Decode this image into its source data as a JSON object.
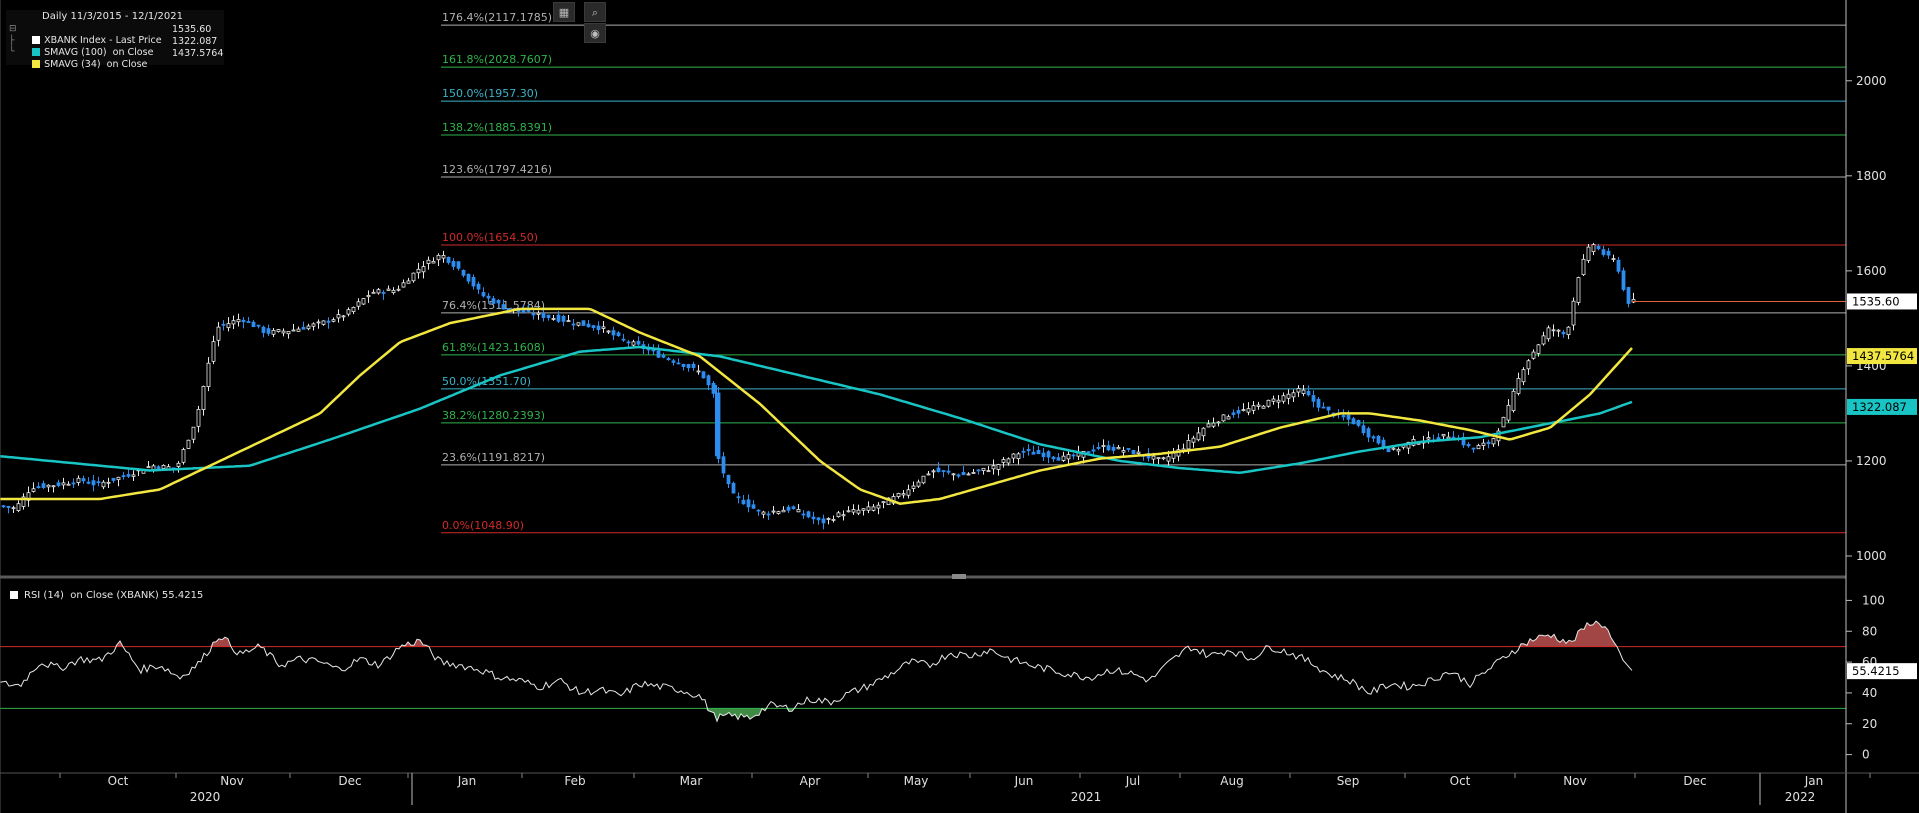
{
  "legend": {
    "header": "Daily 11/3/2015 - 12/1/2021",
    "items": [
      {
        "label": "XBANK Index - Last Price",
        "value": "1535.60",
        "color": "#ffffff"
      },
      {
        "label": "SMAVG (100)  on Close",
        "value": "1322.087",
        "color": "#19c4c4"
      },
      {
        "label": "SMAVG (34)  on Close",
        "value": "1437.5764",
        "color": "#f2e640"
      }
    ]
  },
  "toolbar": {
    "icons": [
      "crop-icon",
      "zoom-icon",
      "record-icon"
    ]
  },
  "rsi_legend": "RSI (14)  on Close (XBANK) 55.4215",
  "chart_data": [
    {
      "type": "candlestick",
      "x_labels_month": [
        "Oct",
        "Nov",
        "Dec",
        "Jan",
        "Feb",
        "Mar",
        "Apr",
        "May",
        "Jun",
        "Jul",
        "Aug",
        "Sep",
        "Oct",
        "Nov",
        "Dec",
        "Jan"
      ],
      "x_labels_year": [
        "2020",
        "2021",
        "2022"
      ],
      "ylim": [
        960,
        2170
      ],
      "y_ticks": [
        1000,
        1200,
        1400,
        1600,
        1800,
        2000
      ],
      "grid": false,
      "last_price": "1535.60",
      "sma100_last": "1322.087",
      "sma34_last": "1437.5764",
      "fib_levels": [
        {
          "label": "176.4%(2117.1785)",
          "value": 2117.1785,
          "color": "#b0b0b0"
        },
        {
          "label": "161.8%(2028.7607)",
          "value": 2028.7607,
          "color": "#2fb34a"
        },
        {
          "label": "150.0%(1957.30)",
          "value": 1957.3,
          "color": "#3bb3c9"
        },
        {
          "label": "138.2%(1885.8391)",
          "value": 1885.8391,
          "color": "#2fb34a"
        },
        {
          "label": "123.6%(1797.4216)",
          "value": 1797.4216,
          "color": "#b0b0b0"
        },
        {
          "label": "100.0%(1654.50)",
          "value": 1654.5,
          "color": "#d12a2a"
        },
        {
          "label": "76.4%(1511.5784)",
          "value": 1511.5784,
          "color": "#b0b0b0"
        },
        {
          "label": "61.8%(1423.1608)",
          "value": 1423.1608,
          "color": "#2fb34a"
        },
        {
          "label": "50.0%(1351.70)",
          "value": 1351.7,
          "color": "#3bb3c9"
        },
        {
          "label": "38.2%(1280.2393)",
          "value": 1280.2393,
          "color": "#2fb34a"
        },
        {
          "label": "23.6%(1191.8217)",
          "value": 1191.8217,
          "color": "#b0b0b0"
        },
        {
          "label": "0.0%(1048.90)",
          "value": 1048.9,
          "color": "#d12a2a"
        }
      ],
      "price_anchors": [
        [
          0,
          1105
        ],
        [
          14,
          1100
        ],
        [
          30,
          1145
        ],
        [
          55,
          1150
        ],
        [
          80,
          1160
        ],
        [
          95,
          1150
        ],
        [
          125,
          1170
        ],
        [
          150,
          1190
        ],
        [
          175,
          1185
        ],
        [
          195,
          1290
        ],
        [
          215,
          1480
        ],
        [
          240,
          1500
        ],
        [
          265,
          1470
        ],
        [
          290,
          1475
        ],
        [
          320,
          1490
        ],
        [
          345,
          1510
        ],
        [
          370,
          1555
        ],
        [
          395,
          1560
        ],
        [
          420,
          1610
        ],
        [
          440,
          1635
        ],
        [
          460,
          1600
        ],
        [
          480,
          1550
        ],
        [
          505,
          1520
        ],
        [
          530,
          1510
        ],
        [
          555,
          1500
        ],
        [
          575,
          1490
        ],
        [
          600,
          1480
        ],
        [
          620,
          1455
        ],
        [
          640,
          1440
        ],
        [
          660,
          1420
        ],
        [
          680,
          1405
        ],
        [
          700,
          1385
        ],
        [
          712,
          1340
        ],
        [
          716,
          1210
        ],
        [
          730,
          1130
        ],
        [
          760,
          1090
        ],
        [
          790,
          1100
        ],
        [
          820,
          1070
        ],
        [
          840,
          1090
        ],
        [
          870,
          1100
        ],
        [
          900,
          1130
        ],
        [
          930,
          1180
        ],
        [
          960,
          1170
        ],
        [
          990,
          1185
        ],
        [
          1020,
          1220
        ],
        [
          1040,
          1215
        ],
        [
          1060,
          1205
        ],
        [
          1080,
          1215
        ],
        [
          1100,
          1230
        ],
        [
          1130,
          1220
        ],
        [
          1160,
          1200
        ],
        [
          1180,
          1225
        ],
        [
          1205,
          1275
        ],
        [
          1230,
          1300
        ],
        [
          1250,
          1310
        ],
        [
          1275,
          1330
        ],
        [
          1300,
          1350
        ],
        [
          1315,
          1320
        ],
        [
          1330,
          1300
        ],
        [
          1350,
          1285
        ],
        [
          1370,
          1250
        ],
        [
          1390,
          1220
        ],
        [
          1410,
          1240
        ],
        [
          1430,
          1245
        ],
        [
          1450,
          1255
        ],
        [
          1470,
          1225
        ],
        [
          1490,
          1240
        ],
        [
          1505,
          1300
        ],
        [
          1520,
          1390
        ],
        [
          1535,
          1440
        ],
        [
          1548,
          1480
        ],
        [
          1565,
          1465
        ],
        [
          1578,
          1600
        ],
        [
          1590,
          1660
        ],
        [
          1605,
          1630
        ],
        [
          1615,
          1620
        ],
        [
          1625,
          1535
        ],
        [
          1632,
          1535
        ]
      ],
      "sma100_anchors": [
        [
          0,
          1210
        ],
        [
          150,
          1180
        ],
        [
          250,
          1190
        ],
        [
          330,
          1245
        ],
        [
          420,
          1310
        ],
        [
          500,
          1380
        ],
        [
          580,
          1430
        ],
        [
          640,
          1440
        ],
        [
          720,
          1420
        ],
        [
          800,
          1380
        ],
        [
          880,
          1340
        ],
        [
          960,
          1290
        ],
        [
          1040,
          1235
        ],
        [
          1120,
          1200
        ],
        [
          1180,
          1185
        ],
        [
          1240,
          1175
        ],
        [
          1300,
          1195
        ],
        [
          1360,
          1220
        ],
        [
          1420,
          1240
        ],
        [
          1480,
          1250
        ],
        [
          1540,
          1275
        ],
        [
          1600,
          1300
        ],
        [
          1633,
          1325
        ]
      ],
      "sma34_anchors": [
        [
          0,
          1120
        ],
        [
          100,
          1120
        ],
        [
          160,
          1140
        ],
        [
          200,
          1180
        ],
        [
          260,
          1240
        ],
        [
          320,
          1300
        ],
        [
          360,
          1380
        ],
        [
          400,
          1450
        ],
        [
          450,
          1490
        ],
        [
          520,
          1520
        ],
        [
          590,
          1520
        ],
        [
          640,
          1470
        ],
        [
          700,
          1420
        ],
        [
          760,
          1320
        ],
        [
          820,
          1200
        ],
        [
          860,
          1140
        ],
        [
          900,
          1110
        ],
        [
          940,
          1120
        ],
        [
          990,
          1150
        ],
        [
          1040,
          1180
        ],
        [
          1100,
          1205
        ],
        [
          1160,
          1215
        ],
        [
          1220,
          1230
        ],
        [
          1280,
          1270
        ],
        [
          1340,
          1300
        ],
        [
          1370,
          1300
        ],
        [
          1420,
          1285
        ],
        [
          1470,
          1265
        ],
        [
          1510,
          1245
        ],
        [
          1550,
          1270
        ],
        [
          1590,
          1340
        ],
        [
          1633,
          1440
        ]
      ]
    },
    {
      "type": "line",
      "ylim": [
        -10,
        110
      ],
      "y_ticks": [
        0,
        20,
        40,
        60,
        80,
        100
      ],
      "overbought": 70,
      "oversold": 30,
      "last_value": "55.4215",
      "rsi_anchors": [
        [
          0,
          46
        ],
        [
          20,
          45
        ],
        [
          40,
          60
        ],
        [
          60,
          56
        ],
        [
          80,
          62
        ],
        [
          100,
          61
        ],
        [
          120,
          72
        ],
        [
          140,
          55
        ],
        [
          160,
          58
        ],
        [
          180,
          50
        ],
        [
          200,
          60
        ],
        [
          220,
          78
        ],
        [
          240,
          65
        ],
        [
          260,
          70
        ],
        [
          280,
          58
        ],
        [
          300,
          62
        ],
        [
          320,
          60
        ],
        [
          340,
          55
        ],
        [
          360,
          62
        ],
        [
          380,
          58
        ],
        [
          400,
          70
        ],
        [
          420,
          74
        ],
        [
          440,
          60
        ],
        [
          460,
          58
        ],
        [
          480,
          55
        ],
        [
          500,
          50
        ],
        [
          520,
          48
        ],
        [
          540,
          44
        ],
        [
          560,
          48
        ],
        [
          580,
          40
        ],
        [
          600,
          42
        ],
        [
          620,
          38
        ],
        [
          640,
          46
        ],
        [
          660,
          44
        ],
        [
          680,
          42
        ],
        [
          700,
          38
        ],
        [
          715,
          24
        ],
        [
          730,
          25
        ],
        [
          750,
          24
        ],
        [
          770,
          32
        ],
        [
          790,
          30
        ],
        [
          810,
          36
        ],
        [
          830,
          34
        ],
        [
          850,
          40
        ],
        [
          870,
          45
        ],
        [
          890,
          52
        ],
        [
          910,
          60
        ],
        [
          930,
          58
        ],
        [
          950,
          66
        ],
        [
          970,
          64
        ],
        [
          990,
          68
        ],
        [
          1010,
          62
        ],
        [
          1030,
          58
        ],
        [
          1050,
          55
        ],
        [
          1070,
          52
        ],
        [
          1090,
          50
        ],
        [
          1110,
          55
        ],
        [
          1130,
          53
        ],
        [
          1150,
          48
        ],
        [
          1170,
          60
        ],
        [
          1190,
          70
        ],
        [
          1210,
          64
        ],
        [
          1230,
          68
        ],
        [
          1250,
          62
        ],
        [
          1270,
          70
        ],
        [
          1290,
          66
        ],
        [
          1310,
          60
        ],
        [
          1330,
          52
        ],
        [
          1350,
          48
        ],
        [
          1370,
          40
        ],
        [
          1390,
          46
        ],
        [
          1410,
          44
        ],
        [
          1430,
          48
        ],
        [
          1450,
          54
        ],
        [
          1470,
          46
        ],
        [
          1490,
          56
        ],
        [
          1510,
          66
        ],
        [
          1530,
          74
        ],
        [
          1550,
          78
        ],
        [
          1570,
          72
        ],
        [
          1590,
          86
        ],
        [
          1605,
          84
        ],
        [
          1615,
          70
        ],
        [
          1625,
          58
        ],
        [
          1632,
          55.4
        ]
      ]
    }
  ]
}
